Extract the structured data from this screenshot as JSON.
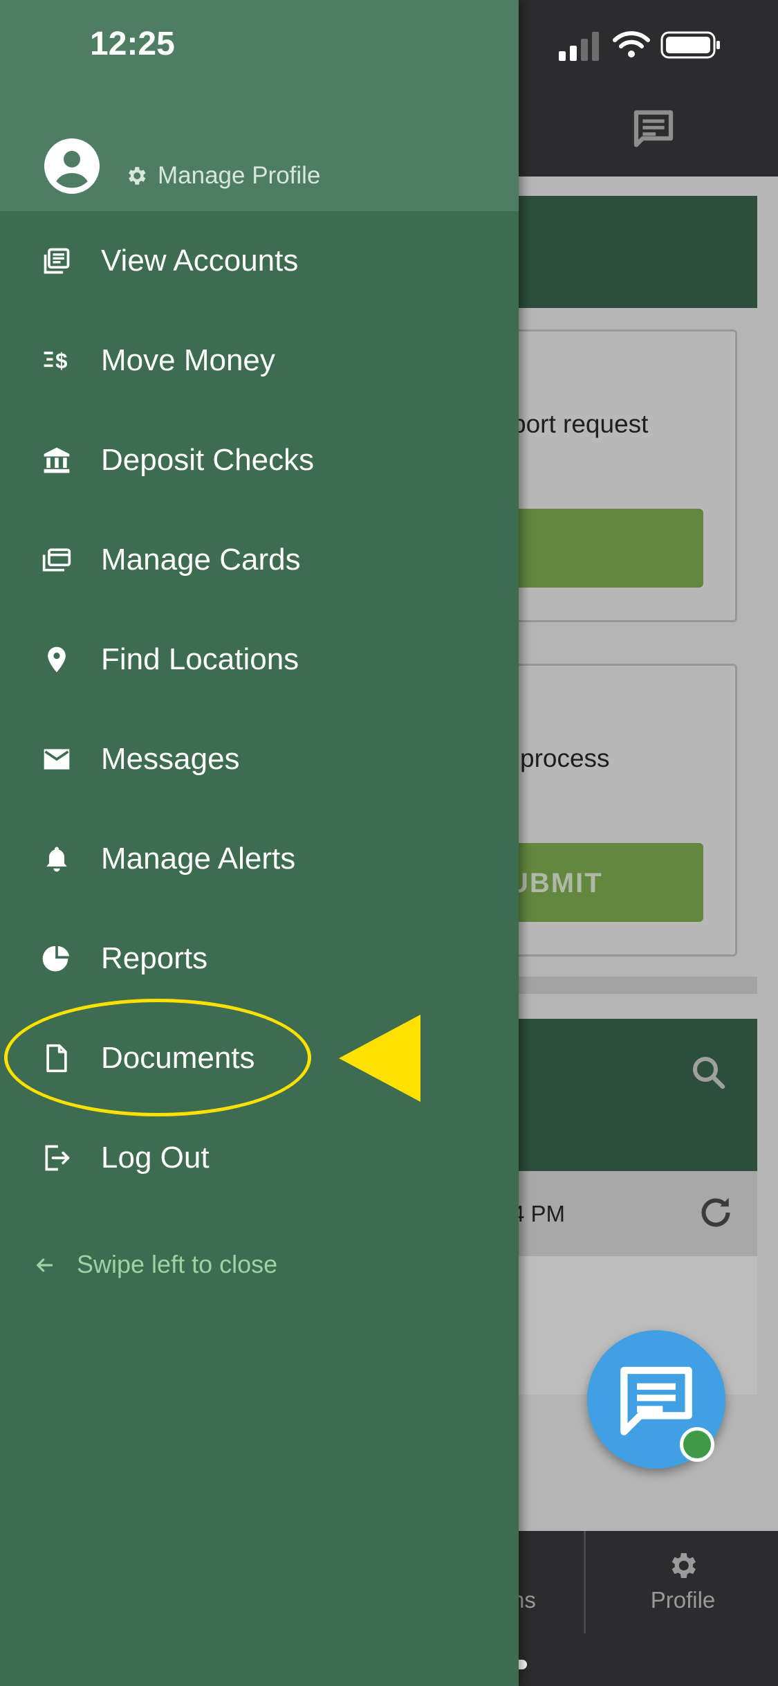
{
  "status_bar": {
    "time": "12:25"
  },
  "drawer": {
    "manage_profile_label": "Manage Profile",
    "items": [
      {
        "label": "View Accounts",
        "icon": "accounts-icon"
      },
      {
        "label": "Move Money",
        "icon": "move-money-icon"
      },
      {
        "label": "Deposit Checks",
        "icon": "bank-icon"
      },
      {
        "label": "Manage Cards",
        "icon": "cards-icon"
      },
      {
        "label": "Find Locations",
        "icon": "location-pin-icon"
      },
      {
        "label": "Messages",
        "icon": "envelope-icon"
      },
      {
        "label": "Manage Alerts",
        "icon": "bell-icon"
      },
      {
        "label": "Reports",
        "icon": "pie-chart-icon"
      },
      {
        "label": "Documents",
        "icon": "document-icon"
      },
      {
        "label": "Log Out",
        "icon": "logout-icon"
      }
    ],
    "swipe_hint": "Swipe left to close"
  },
  "background": {
    "card1_text": "port request",
    "card2_text": "process",
    "card2_button": "UBMIT",
    "card3_time": "4 PM",
    "tab_partial_label": "ns",
    "tab_profile_label": "Profile"
  },
  "colors": {
    "drawer_bg": "#3e6c50",
    "drawer_header_bg": "#4e7d64",
    "annotation": "#ffe100",
    "fab": "#41a0e4"
  }
}
